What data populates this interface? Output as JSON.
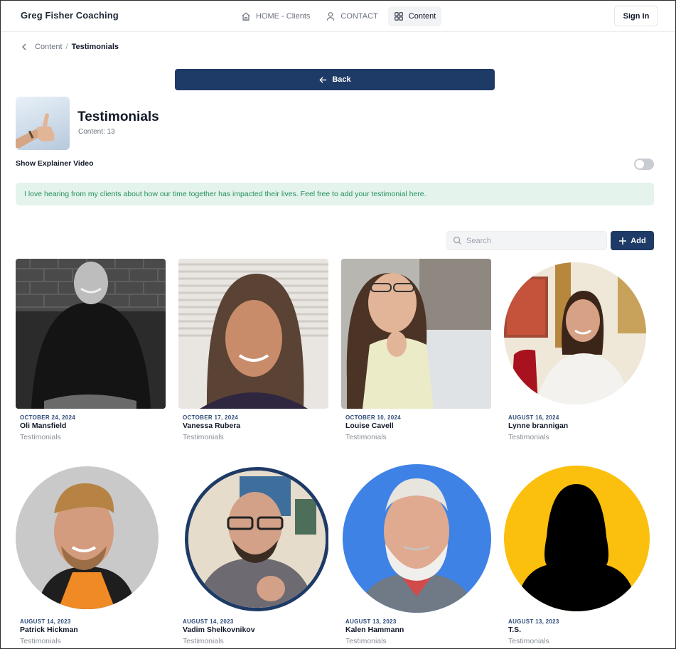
{
  "header": {
    "brand": "Greg Fisher Coaching",
    "nav": [
      {
        "label": "HOME - Clients",
        "icon": "home-icon",
        "active": false
      },
      {
        "label": "CONTACT",
        "icon": "user-icon",
        "active": false
      },
      {
        "label": "Content",
        "icon": "grid-icon",
        "active": true
      }
    ],
    "sign_in": "Sign In"
  },
  "breadcrumb": {
    "parent": "Content",
    "separator": "/",
    "current": "Testimonials"
  },
  "back_button": "Back",
  "collection": {
    "title": "Testimonials",
    "subtitle": "Content: 13"
  },
  "explainer": {
    "label": "Show Explainer Video",
    "enabled": false
  },
  "banner": "I love hearing from my clients about how our time together has impacted their lives.  Feel free to add your testimonial here.",
  "search": {
    "placeholder": "Search",
    "value": ""
  },
  "add_button": "Add",
  "colors": {
    "primary": "#1e3a66",
    "banner_bg": "#e4f3ec",
    "banner_text": "#249060",
    "date_text": "#2c4a78"
  },
  "cards": [
    {
      "date": "OCTOBER 24, 2024",
      "name": "Oli Mansfield",
      "category": "Testimonials",
      "image": "photo-bw-man-smiling"
    },
    {
      "date": "OCTOBER 17, 2024",
      "name": "Vanessa Rubera",
      "category": "Testimonials",
      "image": "photo-woman-long-hair"
    },
    {
      "date": "OCTOBER 10, 2024",
      "name": "Louise Cavell",
      "category": "Testimonials",
      "image": "photo-woman-glasses"
    },
    {
      "date": "AUGUST 16, 2024",
      "name": "Lynne brannigan",
      "category": "Testimonials",
      "image": "photo-woman-circle"
    },
    {
      "date": "AUGUST 14, 2023",
      "name": "Patrick Hickman",
      "category": "Testimonials",
      "image": "photo-man-beard-circle"
    },
    {
      "date": "AUGUST 14, 2023",
      "name": "Vadim Shelkovnikov",
      "category": "Testimonials",
      "image": "photo-man-glasses-circle"
    },
    {
      "date": "AUGUST 13, 2023",
      "name": "Kalen Hammann",
      "category": "Testimonials",
      "image": "photo-older-man-circle"
    },
    {
      "date": "AUGUST 13, 2023",
      "name": "T.S.",
      "category": "Testimonials",
      "image": "placeholder-silhouette"
    }
  ]
}
